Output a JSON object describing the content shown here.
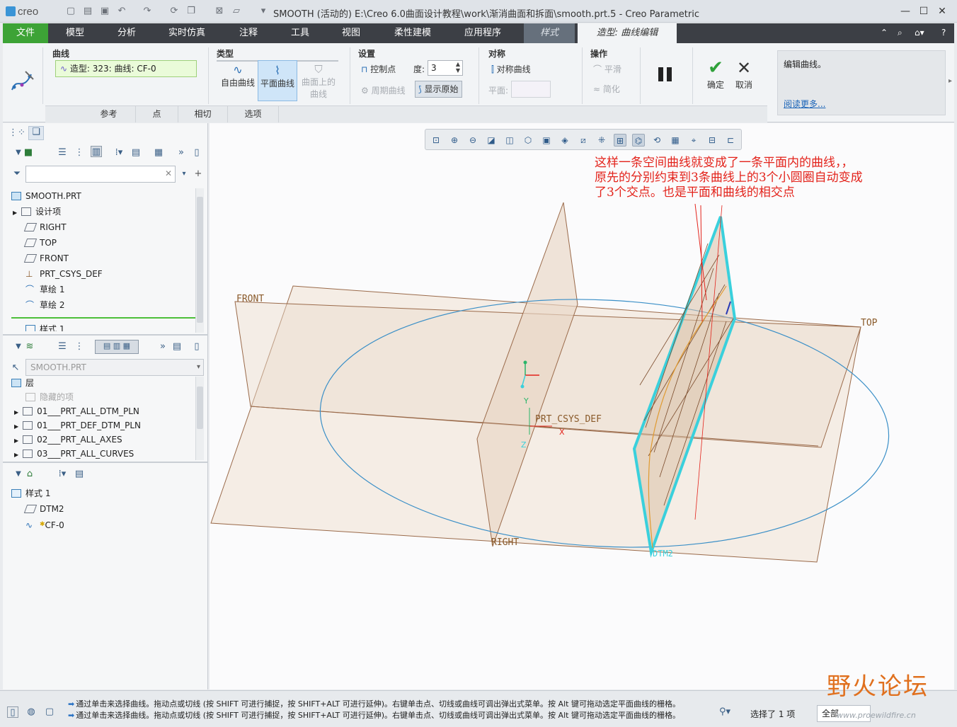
{
  "app": {
    "logo": "creo",
    "window_title": "SMOOTH (活动的) E:\\Creo 6.0曲面设计教程\\work\\渐消曲面和拆面\\smooth.prt.5 - Creo Parametric"
  },
  "tabs": [
    "文件",
    "模型",
    "分析",
    "实时仿真",
    "注释",
    "工具",
    "视图",
    "柔性建模",
    "应用程序",
    "样式",
    "造型: 曲线编辑"
  ],
  "ribbon": {
    "curve": {
      "title": "曲线",
      "collector": "造型: 323: 曲线: CF-0"
    },
    "type": {
      "title": "类型",
      "free": "自由曲线",
      "planar": "平面曲线",
      "cos_line1": "曲面上的",
      "cos_line2": "曲线"
    },
    "settings": {
      "title": "设置",
      "control_points": "控制点",
      "degree_label": "度:",
      "degree_value": "3",
      "periodic": "周期曲线",
      "show_original": "显示原始"
    },
    "symmetry": {
      "title": "对称",
      "sym_curve": "对称曲线",
      "plane_label": "平面:"
    },
    "ops": {
      "title": "操作",
      "smooth": "平滑",
      "simplify": "简化"
    },
    "ok": "确定",
    "cancel": "取消",
    "help_text": "编辑曲线。",
    "help_link": "阅读更多...",
    "dyn_tabs": [
      "参考",
      "点",
      "相切",
      "选项"
    ]
  },
  "model_tree": {
    "items": [
      "SMOOTH.PRT",
      "设计项",
      "RIGHT",
      "TOP",
      "FRONT",
      "PRT_CSYS_DEF",
      "草绘 1",
      "草绘 2",
      "样式 1"
    ]
  },
  "layer_tree": {
    "model": "SMOOTH.PRT",
    "root": "层",
    "items": [
      "隐藏的项",
      "01___PRT_ALL_DTM_PLN",
      "01___PRT_DEF_DTM_PLN",
      "02___PRT_ALL_AXES",
      "03___PRT_ALL_CURVES"
    ]
  },
  "style_tree": {
    "items": [
      "样式 1",
      "DTM2",
      "CF-0"
    ]
  },
  "canvas": {
    "annotation": "这样一条空间曲线就变成了一条平面内的曲线，，原先的分别约束到3条曲线上的3个小圆圈自动变成了3个交点。也是平面和曲线的相交点",
    "labels": {
      "front": "FRONT",
      "top": "TOP",
      "right": "RIGHT",
      "csys": "PRT_CSYS_DEF",
      "dtm2": "DTM2",
      "x": "X",
      "y": "Y",
      "z": "Z"
    }
  },
  "status": {
    "msg1": "通过单击来选择曲线。拖动点或切线 (按 SHIFT 可进行捕捉，按 SHIFT+ALT 可进行延伸)。右键单击点、切线或曲线可调出弹出式菜单。按 Alt 键可拖动选定平面曲线的栅格。",
    "msg2": "通过单击来选择曲线。拖动点或切线 (按 SHIFT 可进行捕捉，按 SHIFT+ALT 可进行延伸)。右键单击点、切线或曲线可调出弹出式菜单。按 Alt 键可拖动选定平面曲线的栅格。",
    "selected": "选择了 1 项",
    "filter": "全部",
    "watermark_cn": "野火论坛",
    "watermark_url": "www.proewildfire.cn"
  },
  "colors": {
    "file_tab": "#3da336",
    "tabbar": "#3c3f45",
    "annotation": "#e3231b",
    "datum": "#9a6a4a",
    "curve": "#3a8fc7",
    "highlight": "#3ad0dc"
  }
}
